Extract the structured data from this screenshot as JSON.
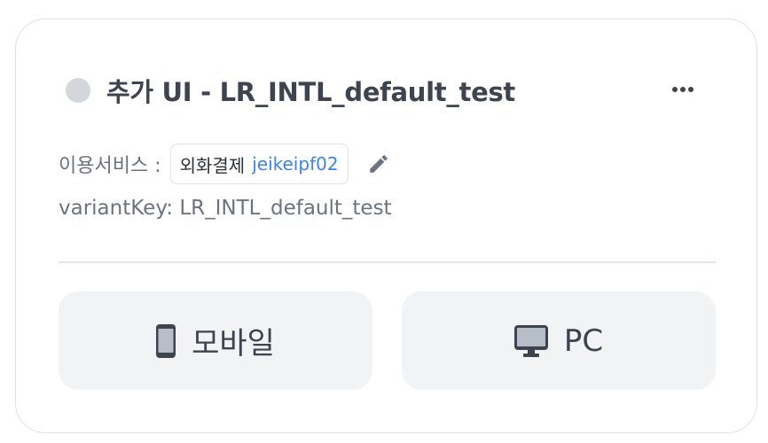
{
  "card": {
    "title": "추가 UI - LR_INTL_default_test",
    "status_color": "#d3d7dc",
    "more_icon": "more-horizontal-icon"
  },
  "service": {
    "label": "이용서비스 :",
    "name": "외화결제",
    "id": "jeikeipf02",
    "edit_icon": "pencil-icon"
  },
  "variant": {
    "text": "variantKey: LR_INTL_default_test"
  },
  "devices": [
    {
      "label": "모바일",
      "icon": "mobile-icon"
    },
    {
      "label": "PC",
      "icon": "monitor-icon"
    }
  ],
  "colors": {
    "accent": "#3b82f6",
    "button_bg": "#f2f3f5",
    "text_dark": "#3d4450",
    "text_muted": "#6b7280"
  }
}
